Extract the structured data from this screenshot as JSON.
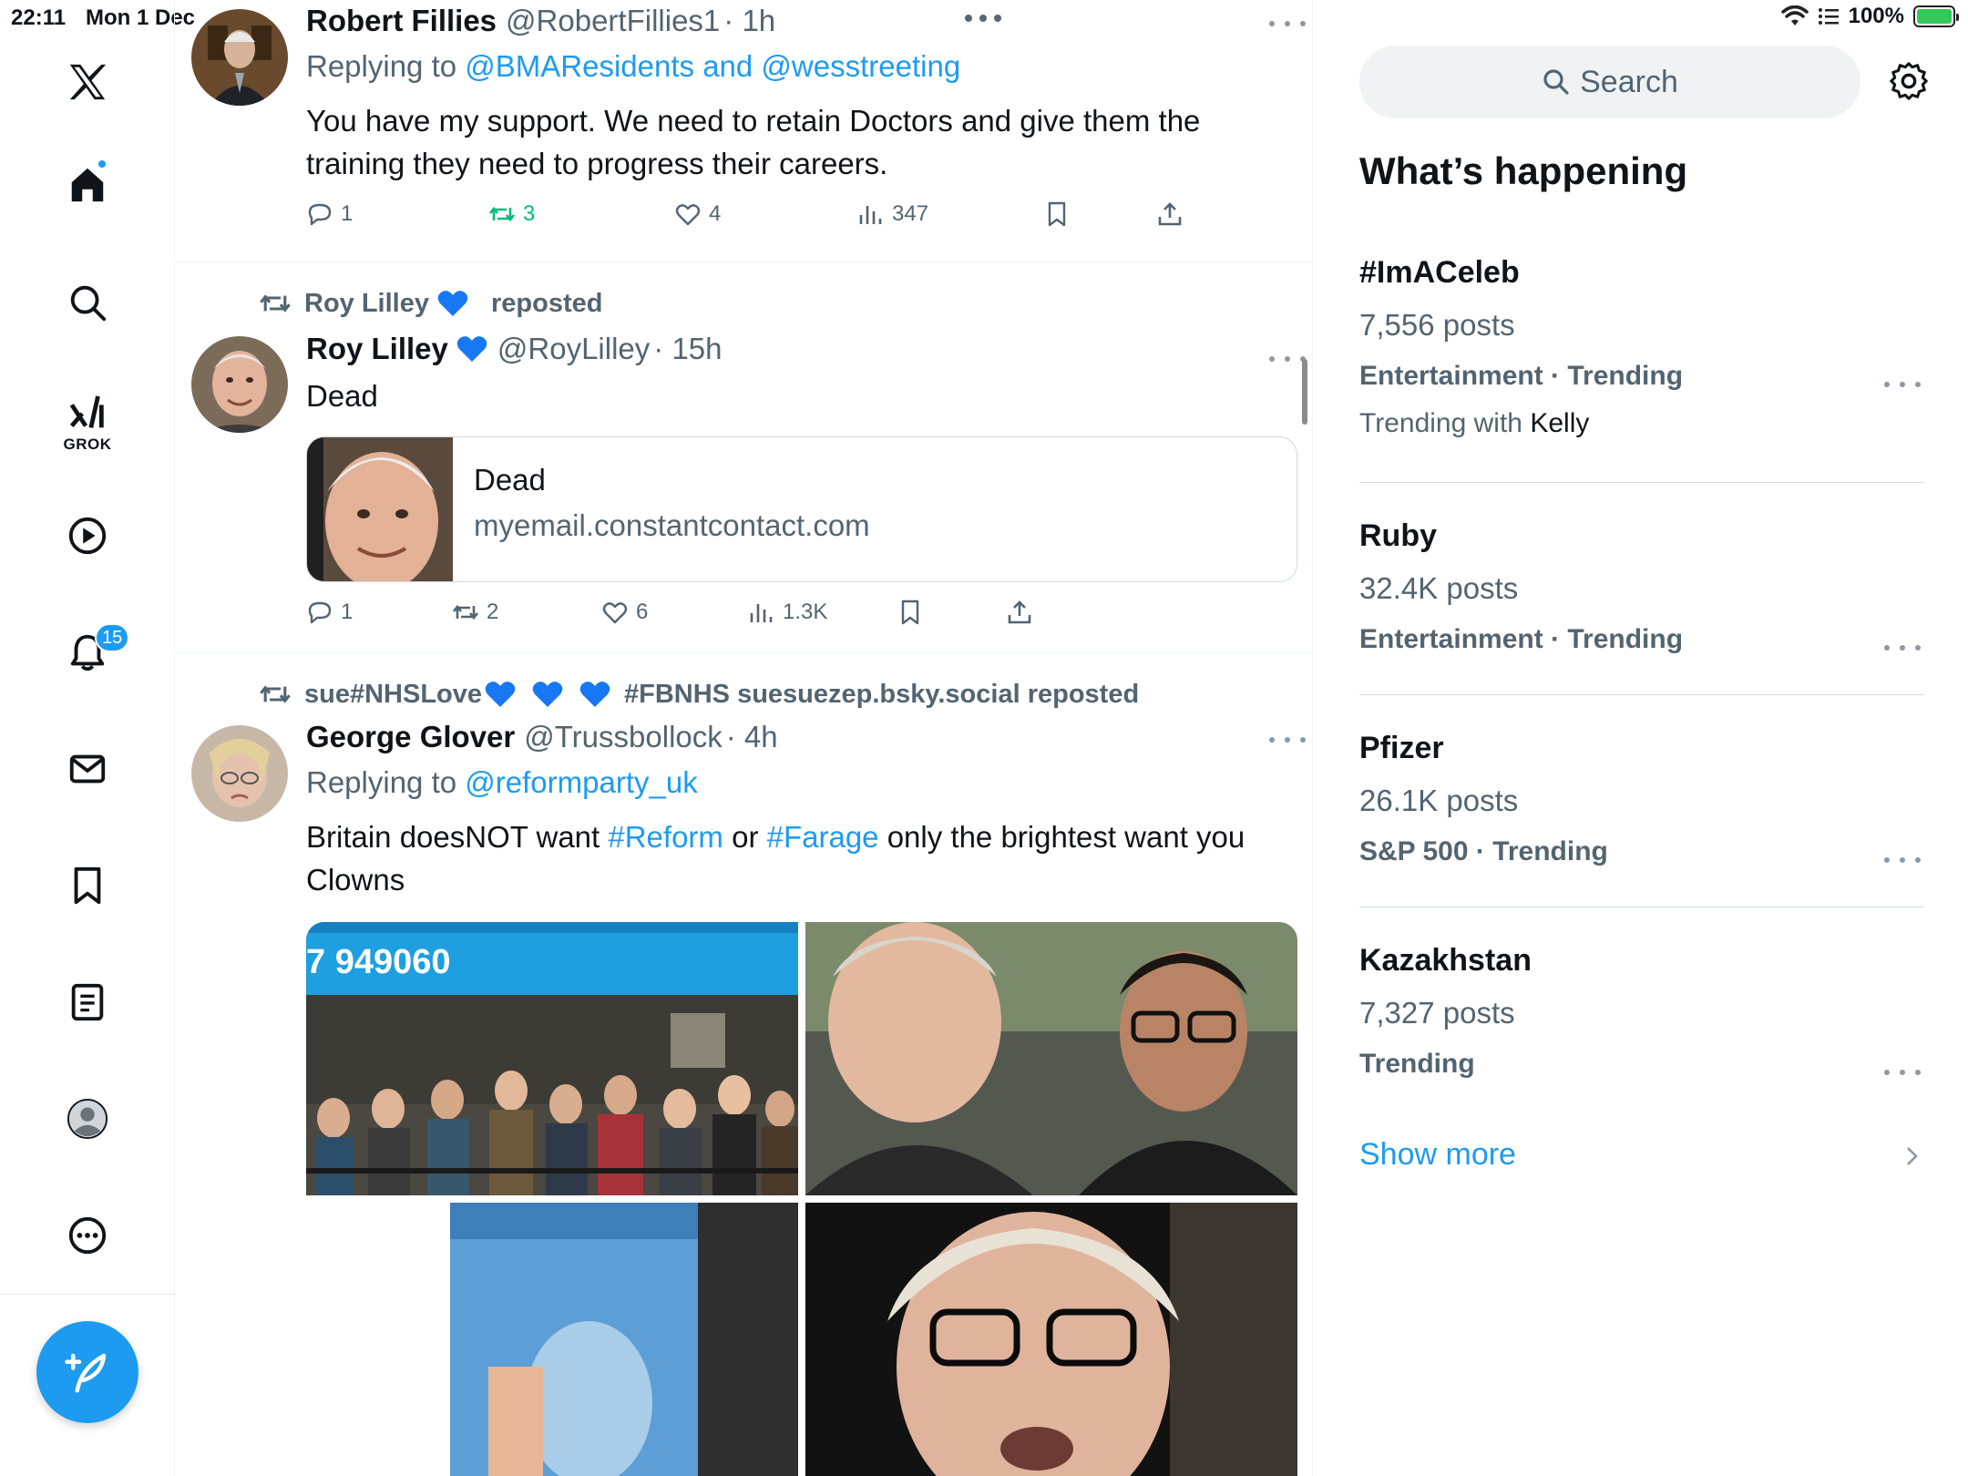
{
  "status": {
    "time": "22:11",
    "date": "Mon 1 Dec",
    "battery": "100%"
  },
  "nav": {
    "grok_label": "GROK",
    "notification_count": "15"
  },
  "tweets": [
    {
      "name": "Robert Fillies",
      "handle": "@RobertFillies1",
      "time": "· 1h",
      "reply_prefix": "Replying to",
      "reply_to": "@BMAResidents and @wesstreeting",
      "text_line1": "You have my support. We need to retain Doctors and give them the",
      "text_line2": "training they need to progress their careers.",
      "replies": "1",
      "reposts": "3",
      "likes": "4",
      "views": "347"
    },
    {
      "repost_by": "Roy Lilley",
      "repost_suffix": "reposted",
      "name": "Roy Lilley",
      "handle": "@RoyLilley",
      "time": "· 15h",
      "text": "Dead",
      "card_title": "Dead",
      "card_domain": "myemail.constantcontact.com",
      "replies": "1",
      "reposts": "2",
      "likes": "6",
      "views": "1.3K"
    },
    {
      "repost_by_prefix": "sue#NHSLove",
      "repost_by_suffix": "#FBNHS suesuezep.bsky.social reposted",
      "name": "George Glover",
      "handle": "@Trussbollock",
      "time": "· 4h",
      "reply_prefix": "Replying to",
      "reply_to": "@reformparty_uk",
      "text_a": "Britain doesNOT want ",
      "text_tag1": "#Reform",
      "text_b": " or ",
      "text_tag2": "#Farage",
      "text_c": " only the brightest want you",
      "text_line2": "Clowns",
      "photo_sign_text": "7 949060"
    }
  ],
  "right": {
    "search_placeholder": "Search",
    "section_title": "What’s happening",
    "trends": [
      {
        "name": "#ImACeleb",
        "posts": "7,556 posts",
        "category": "Entertainment · Trending",
        "with_prefix": "Trending with",
        "with_name": "Kelly"
      },
      {
        "name": "Ruby",
        "posts": "32.4K posts",
        "category": "Entertainment · Trending"
      },
      {
        "name": "Pfizer",
        "posts": "26.1K posts",
        "category": "S&P 500 · Trending"
      },
      {
        "name": "Kazakhstan",
        "posts": "7,327 posts",
        "category": "Trending"
      }
    ],
    "show_more": "Show more"
  },
  "colors": {
    "accent": "#1d9bf0",
    "repost_green": "#00ba7c",
    "muted": "#536471"
  }
}
